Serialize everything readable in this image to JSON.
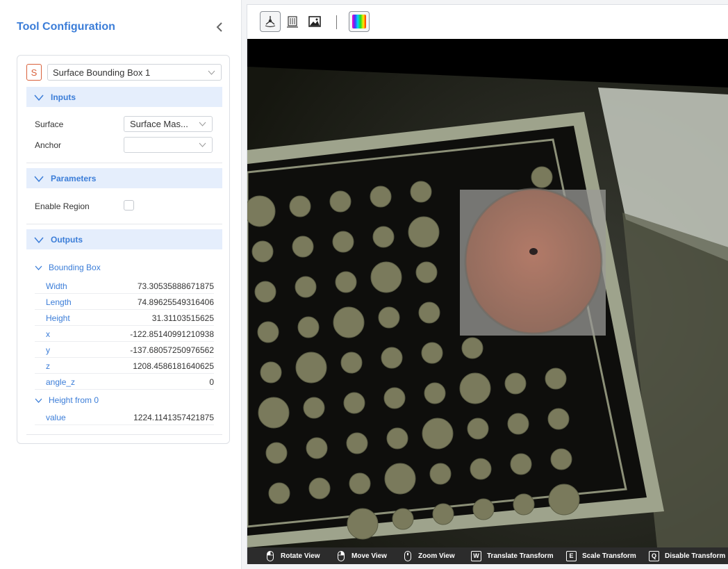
{
  "panel": {
    "title": "Tool Configuration",
    "tool": {
      "badge": "S",
      "name": "Surface Bounding Box 1"
    },
    "inputs": {
      "title": "Inputs",
      "surface_label": "Surface",
      "surface_value": "Surface Mas...",
      "anchor_label": "Anchor",
      "anchor_value": ""
    },
    "parameters": {
      "title": "Parameters",
      "enable_region_label": "Enable Region",
      "enable_region_checked": false
    },
    "outputs": {
      "title": "Outputs",
      "bbox": {
        "title": "Bounding Box",
        "rows": [
          {
            "key": "Width",
            "value": "73.30535888671875"
          },
          {
            "key": "Length",
            "value": "74.89625549316406"
          },
          {
            "key": "Height",
            "value": "31.31103515625"
          },
          {
            "key": "x",
            "value": "-122.85140991210938"
          },
          {
            "key": "y",
            "value": "-137.68057250976562"
          },
          {
            "key": "z",
            "value": "1208.4586181640625"
          },
          {
            "key": "angle_z",
            "value": "0"
          }
        ]
      },
      "height": {
        "title": "Height from 0",
        "rows": [
          {
            "key": "value",
            "value": "1224.1141357421875"
          }
        ]
      }
    }
  },
  "viewer": {
    "toolbar": [
      "3d-view-icon",
      "depth-map-icon",
      "image-icon",
      "colormap-icon"
    ],
    "status": {
      "rotate": "Rotate View",
      "move": "Move View",
      "zoom": "Zoom View",
      "translate_key": "W",
      "translate": "Translate Transform",
      "scale_key": "E",
      "scale": "Scale Transform",
      "disable_key": "Q",
      "disable": "Disable Transform"
    }
  },
  "colors": {
    "accent": "#3b7dd8",
    "section_bg": "#e5eefc",
    "tool_badge": "#d9603a"
  }
}
